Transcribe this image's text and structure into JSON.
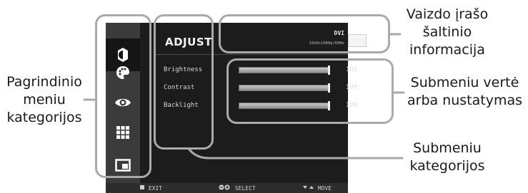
{
  "osd": {
    "title": "ADJUST",
    "source": {
      "label": "DVI",
      "resolution": "1920x1080p/60Hz"
    },
    "items": [
      {
        "label": "Brightness",
        "value": "100",
        "level": 1.0
      },
      {
        "label": "Contrast",
        "value": "100",
        "level": 1.0
      },
      {
        "label": "Backlight",
        "value": "100",
        "level": 1.0
      }
    ],
    "categories": [
      "brightness-icon",
      "palette-icon",
      "eye-icon",
      "grid-icon",
      "picture-in-picture-icon"
    ],
    "footer": {
      "exit": "EXIT",
      "select": "SELECT",
      "move": "MOVE"
    },
    "colors": {
      "background": "#1c1c1c",
      "sidebar": "#3b3b3b",
      "callout": "#aaaaaa"
    }
  },
  "annotations": {
    "source_info": [
      "Vaizdo įrašo",
      "šaltinio",
      "informacija"
    ],
    "main_menu": [
      "Pagrindinio",
      "meniu",
      "kategorijos"
    ],
    "submenu_value": [
      "Submeniu vertė",
      "arba nustatymas"
    ],
    "submenu_categories": [
      "Submeniu",
      "kategorijos"
    ]
  }
}
